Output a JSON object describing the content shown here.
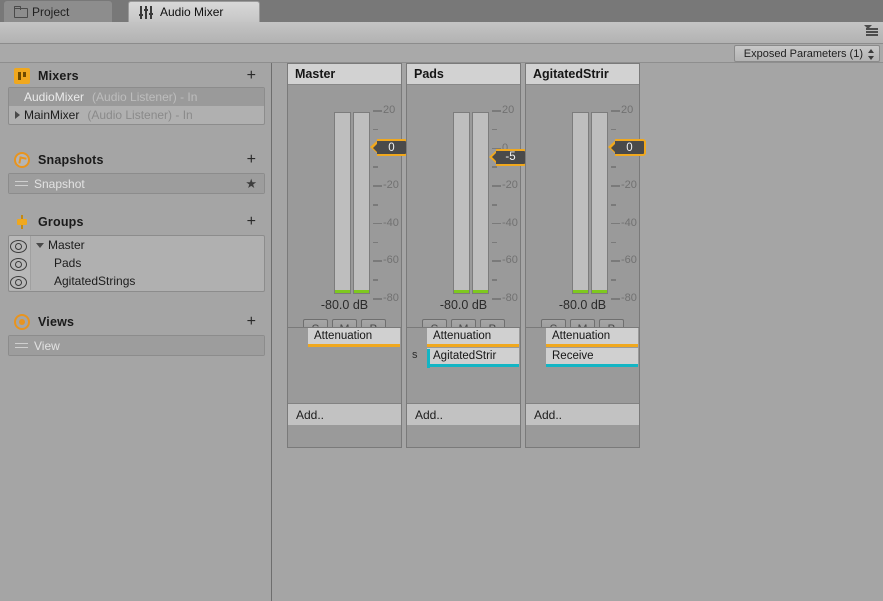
{
  "window": {
    "tabs": [
      {
        "label": "Project",
        "icon": "folder-icon",
        "active": false
      },
      {
        "label": "Audio Mixer",
        "icon": "audio-mixer-icon",
        "active": true
      }
    ],
    "menu_icon": "hamburger-menu-icon"
  },
  "toolbar": {
    "exposed_parameters_label": "Exposed Parameters (1)",
    "dropdown_icon": "updown-arrows-icon"
  },
  "sidebar": {
    "sections": [
      {
        "title": "Mixers",
        "icon": "mixers-icon",
        "add_label": "+",
        "rows": [
          {
            "name": "AudioMixer",
            "detail": "(Audio Listener) - In",
            "selected": true,
            "expandable": false
          },
          {
            "name": "MainMixer",
            "detail": "(Audio Listener) - In",
            "selected": false,
            "expandable": true
          }
        ]
      },
      {
        "title": "Snapshots",
        "icon": "snapshots-icon",
        "add_label": "+",
        "rows": [
          {
            "name": "Snapshot",
            "selected": true,
            "starred": true
          }
        ]
      },
      {
        "title": "Groups",
        "icon": "groups-icon",
        "add_label": "+",
        "rows": [
          {
            "name": "Master",
            "indent": 0,
            "expanded": true,
            "visibility_icon": "eye-icon"
          },
          {
            "name": "Pads",
            "indent": 1,
            "expanded": false,
            "visibility_icon": "eye-icon"
          },
          {
            "name": "AgitatedStrings",
            "indent": 1,
            "expanded": false,
            "visibility_icon": "eye-icon"
          }
        ]
      },
      {
        "title": "Views",
        "icon": "views-icon",
        "add_label": "+",
        "rows": [
          {
            "name": "View",
            "selected": true
          }
        ]
      }
    ]
  },
  "mixer": {
    "scale": {
      "labels": [
        "20",
        "0",
        "-20",
        "-40",
        "-60",
        "-80"
      ],
      "top_db": 20,
      "bottom_db": -80
    },
    "solo_label": "S",
    "mute_label": "M",
    "bypass_label": "B",
    "add_effect_label": "Add..",
    "strips": [
      {
        "name": "Master",
        "fader_value": "0",
        "fader_db": 0,
        "db_readout": "-80.0 dB",
        "effects": [
          {
            "name": "Attenuation",
            "color": "#f0a81e",
            "send": false
          }
        ]
      },
      {
        "name": "Pads",
        "fader_value": "-5",
        "fader_db": -5,
        "db_readout": "-80.0 dB",
        "effects": [
          {
            "name": "Attenuation",
            "color": "#f0a81e",
            "send": false
          },
          {
            "name": "AgitatedStrir",
            "color": "#13b5c4",
            "send": true,
            "send_label": "s"
          }
        ]
      },
      {
        "name": "AgitatedStrir",
        "fader_value": "0",
        "fader_db": 0,
        "db_readout": "-80.0 dB",
        "effects": [
          {
            "name": "Attenuation",
            "color": "#f0a81e",
            "send": false
          },
          {
            "name": "Receive",
            "color": "#13b5c4",
            "send": false
          }
        ]
      }
    ]
  }
}
